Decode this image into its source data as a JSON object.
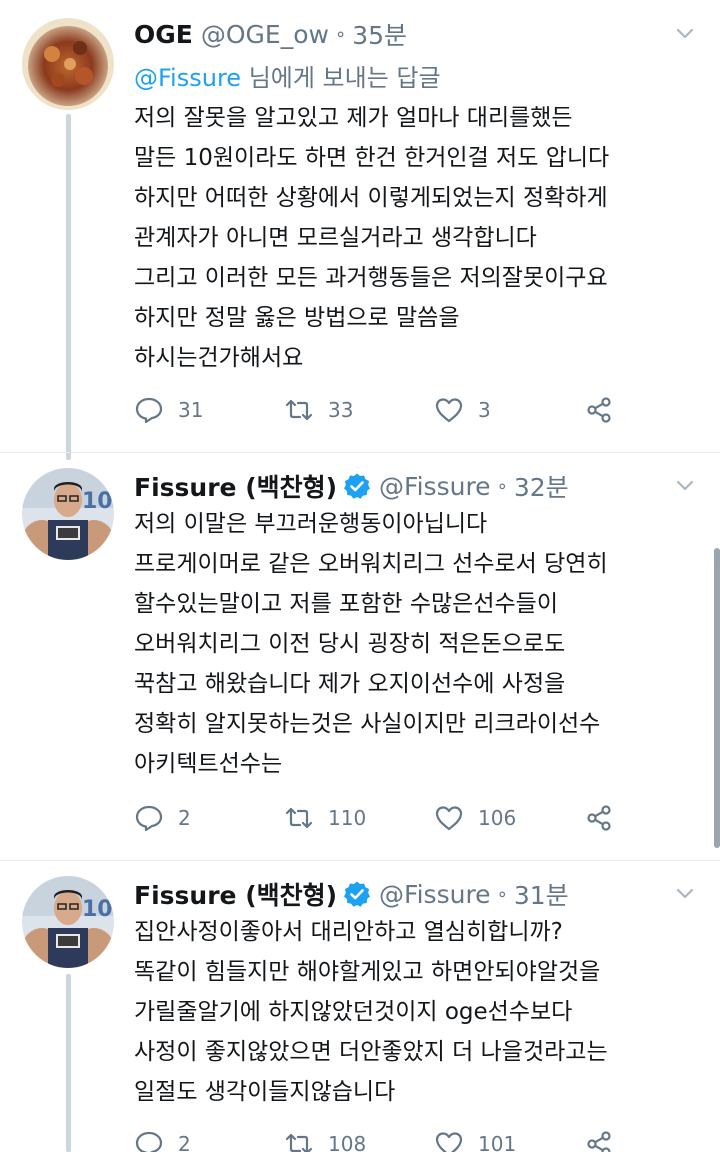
{
  "tweets": [
    {
      "name": "OGE",
      "handle": "@OGE_ow",
      "dot": "∘",
      "time": "35분",
      "reply_mention": "@Fissure",
      "reply_suffix": " 님에게 보내는 답글",
      "lines": [
        "저의 잘못을 알고있고 제가 얼마나 대리를했든",
        "말든 10원이라도 하면 한건 한거인걸 저도 압니다",
        "하지만 어떠한 상황에서 이렇게되었는지 정확하게",
        "관계자가 아니면 모르실거라고 생각합니다",
        "그리고 이러한 모든 과거행동들은 저의잘못이구요",
        "하지만 정말 옳은 방법으로 말씀을",
        "하시는건가해서요"
      ],
      "replies": "31",
      "retweets": "33",
      "likes": "3"
    },
    {
      "name": "Fissure (백찬형)",
      "handle": "@Fissure",
      "dot": "∘",
      "time": "32분",
      "lines": [
        "저의 이말은 부끄러운행동이아닙니다",
        "프로게이머로 같은 오버워치리그 선수로서 당연히",
        "할수있는말이고 저를 포함한 수많은선수들이",
        "오버워치리그 이전 당시 굉장히 적은돈으로도",
        "꾹참고 해왔습니다 제가 오지이선수에 사정을",
        "정확히 알지못하는것은 사실이지만 리크라이선수",
        "아키텍트선수는"
      ],
      "replies": "2",
      "retweets": "110",
      "likes": "106"
    },
    {
      "name": "Fissure (백찬형)",
      "handle": "@Fissure",
      "dot": "∘",
      "time": "31분",
      "lines": [
        "집안사정이좋아서 대리안하고 열심히합니까?",
        "똑같이 힘들지만 해야할게있고 하면안되야알것을",
        "가릴줄알기에 하지않았던것이지 oge선수보다",
        "사정이 좋지않았으면 더안좋았지 더 나을것라고는",
        "일절도 생각이들지않습니다"
      ],
      "replies": "2",
      "retweets": "108",
      "likes": "101"
    }
  ],
  "icons": {
    "reply": "reply-icon",
    "retweet": "retweet-icon",
    "like": "heart-icon",
    "share": "share-icon",
    "verified": "verified-badge-icon",
    "caret": "chevron-down-icon"
  },
  "colors": {
    "link": "#1da1f2",
    "muted": "#657786",
    "text": "#14171a",
    "thread": "#ccd6dd"
  }
}
